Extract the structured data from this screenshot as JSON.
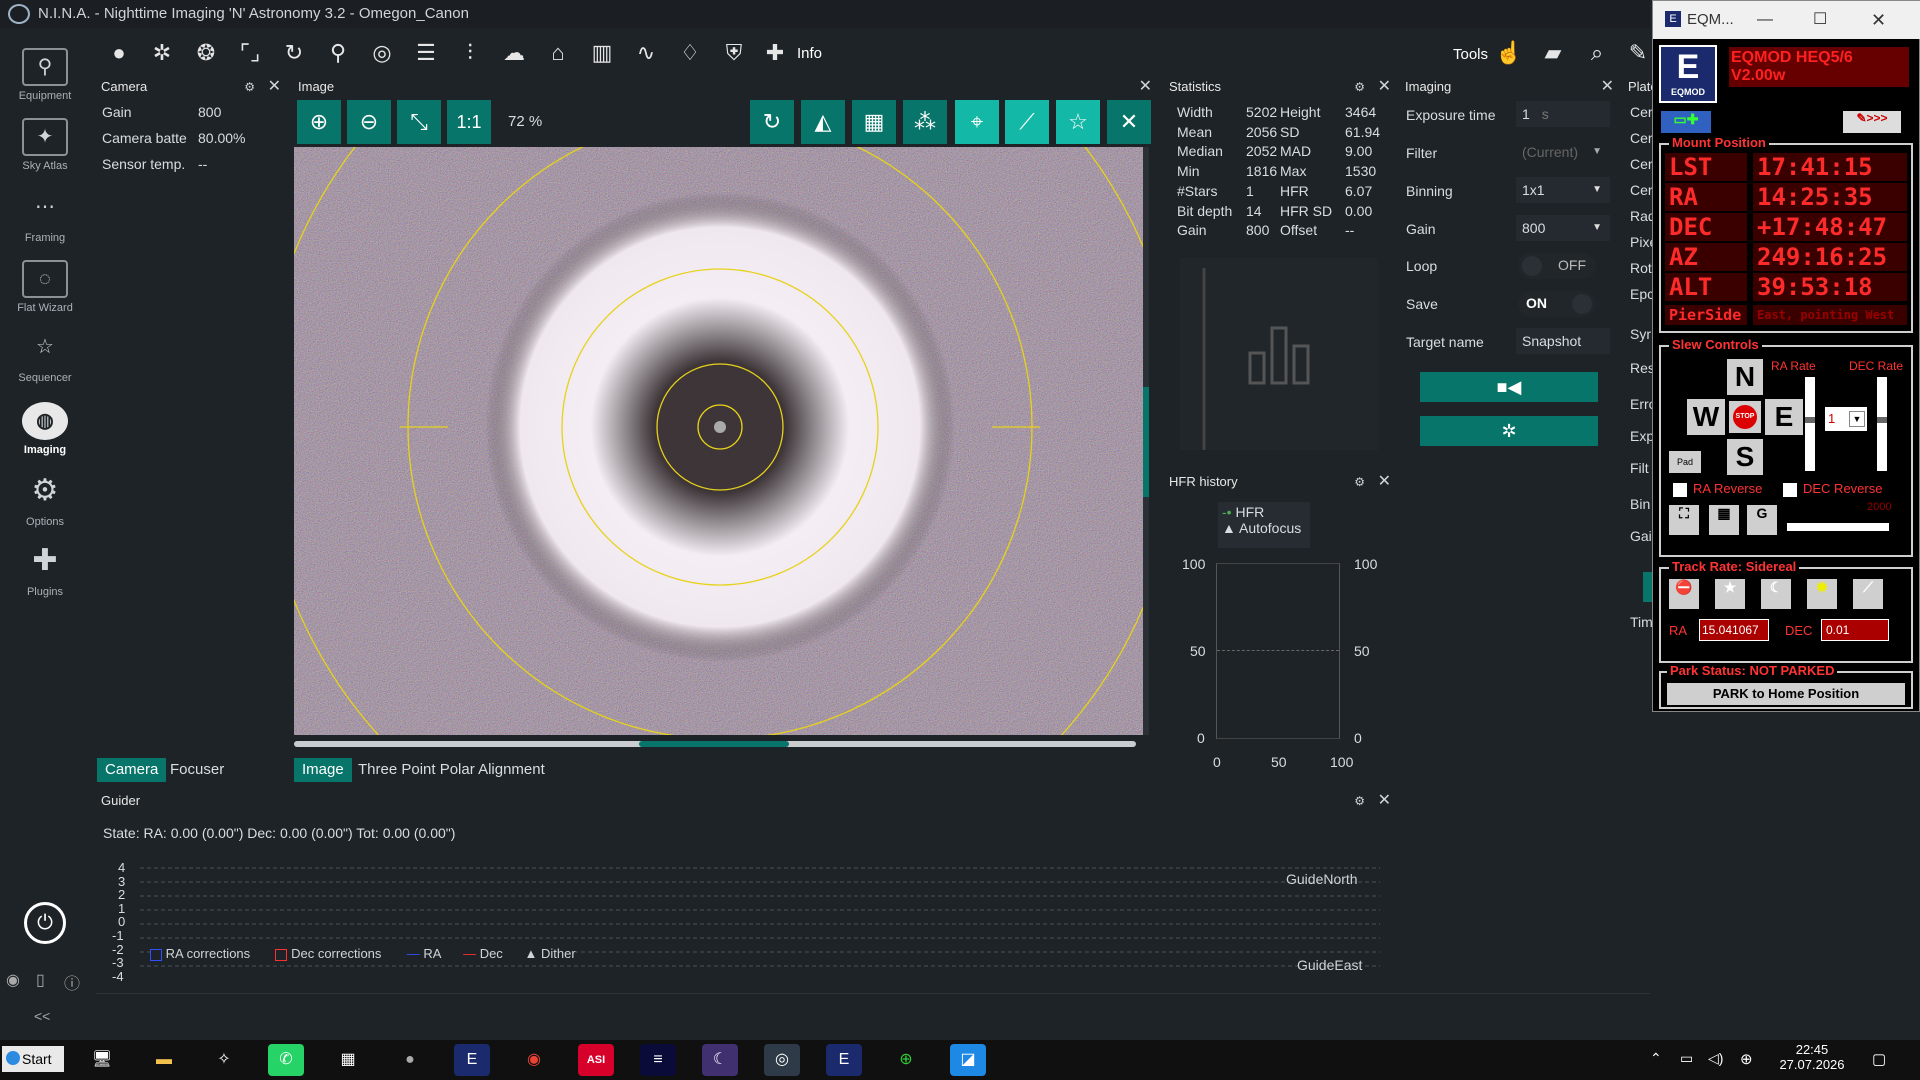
{
  "window": {
    "title": "N.I.N.A. - Nighttime Imaging 'N' Astronomy 3.2   -  Omegon_Canon"
  },
  "toolbar": {
    "info_label": "Info",
    "tools_label": "Tools"
  },
  "sidebar": {
    "items": [
      {
        "label": "Equipment",
        "icon": "telescope-icon"
      },
      {
        "label": "Sky Atlas",
        "icon": "map-icon"
      },
      {
        "label": "Framing",
        "icon": "framing-icon"
      },
      {
        "label": "Flat Wizard",
        "icon": "flat-icon"
      },
      {
        "label": "Sequencer",
        "icon": "list-icon"
      },
      {
        "label": "Imaging",
        "icon": "imaging-icon"
      },
      {
        "label": "Options",
        "icon": "gear-icon"
      },
      {
        "label": "Plugins",
        "icon": "puzzle-icon"
      }
    ],
    "collapse": "<<"
  },
  "camera": {
    "title": "Camera",
    "rows": [
      {
        "k": "Gain",
        "v": "800"
      },
      {
        "k": "Camera batte",
        "v": "80.00%"
      },
      {
        "k": "Sensor temp.",
        "v": "--"
      }
    ],
    "tabs": [
      "Camera",
      "Focuser"
    ]
  },
  "image": {
    "title": "Image",
    "zoom": "72 %",
    "one_to_one": "1:1",
    "tabs": [
      "Image",
      "Three Point Polar Alignment"
    ]
  },
  "statistics": {
    "title": "Statistics",
    "rows": [
      [
        "Width",
        "5202",
        "Height",
        "3464"
      ],
      [
        "Mean",
        "2056",
        "SD",
        "61.94"
      ],
      [
        "Median",
        "2052",
        "MAD",
        "9.00"
      ],
      [
        "Min",
        "1816",
        "Max",
        "1530"
      ],
      [
        "#Stars",
        "1",
        "HFR",
        "6.07"
      ],
      [
        "Bit depth",
        "14",
        "HFR SD",
        "0.00"
      ],
      [
        "Gain",
        "800",
        "Offset",
        "--"
      ]
    ]
  },
  "hfr": {
    "title": "HFR history",
    "legend": [
      "HFR",
      "Autofocus"
    ],
    "yticks": [
      "100",
      "50",
      "0"
    ],
    "xticks": [
      "0",
      "50",
      "100"
    ]
  },
  "imaging": {
    "title": "Imaging",
    "exposure_label": "Exposure time",
    "exposure_value": "1",
    "exposure_unit": "s",
    "filter_label": "Filter",
    "filter_value": "(Current)",
    "binning_label": "Binning",
    "binning_value": "1x1",
    "gain_label": "Gain",
    "gain_value": "800",
    "loop_label": "Loop",
    "loop_value": "OFF",
    "save_label": "Save",
    "save_value": "ON",
    "target_label": "Target name",
    "target_value": "Snapshot"
  },
  "plate": {
    "title": "Plate",
    "rows": [
      "Cer",
      "Cer",
      "Cer",
      "Cer",
      "Rad",
      "Pixe",
      "Rot",
      "Epc",
      "Syr",
      "Res",
      "Erro",
      "Exp",
      "Filt",
      "Bin",
      "Gai",
      "Tim"
    ]
  },
  "guider": {
    "title": "Guider",
    "state": "State:   RA: 0.00 (0.00\")  Dec: 0.00 (0.00\")  Tot: 0.00 (0.00\")",
    "yticks": [
      "4",
      "3",
      "2",
      "1",
      "0",
      "-1",
      "-2",
      "-3",
      "-4"
    ],
    "north": "GuideNorth",
    "east": "GuideEast",
    "legend": [
      "RA corrections",
      "Dec corrections",
      "RA",
      "Dec",
      "Dither"
    ]
  },
  "eqmod": {
    "title": "EQM...",
    "banner": "EQMOD HEQ5/6",
    "version": "V2.00w",
    "logo_text": "EQMOD",
    "mount_position": "Mount Position",
    "rows": [
      {
        "k": "LST",
        "v": "17:41:15"
      },
      {
        "k": "RA",
        "v": "14:25:35"
      },
      {
        "k": "DEC",
        "v": "+17:48:47"
      },
      {
        "k": "AZ",
        "v": "249:16:25"
      },
      {
        "k": "ALT",
        "v": "39:53:18"
      }
    ],
    "pierside_label": "PierSide",
    "pierside_value": "East, pointing West",
    "slew_controls": "Slew Controls",
    "ra_rate": "RA Rate",
    "dec_rate": "DEC Rate",
    "n": "N",
    "s": "S",
    "e": "E",
    "w": "W",
    "stop": "STOP",
    "pad": "Pad",
    "rate_value": "1",
    "ra_reverse": "RA Reverse",
    "dec_reverse": "DEC Reverse",
    "slider_value": "2000",
    "track_rate": "Track Rate: Sidereal",
    "ra_label": "RA",
    "ra_value": "15.041067",
    "dec_label": "DEC",
    "dec_value": "0.01",
    "park_status": "Park Status: NOT PARKED",
    "park_button": "PARK to Home Position"
  },
  "taskbar": {
    "start": "Start",
    "time": "22:45",
    "date": "27.07.2026",
    "asi": "ASI"
  }
}
